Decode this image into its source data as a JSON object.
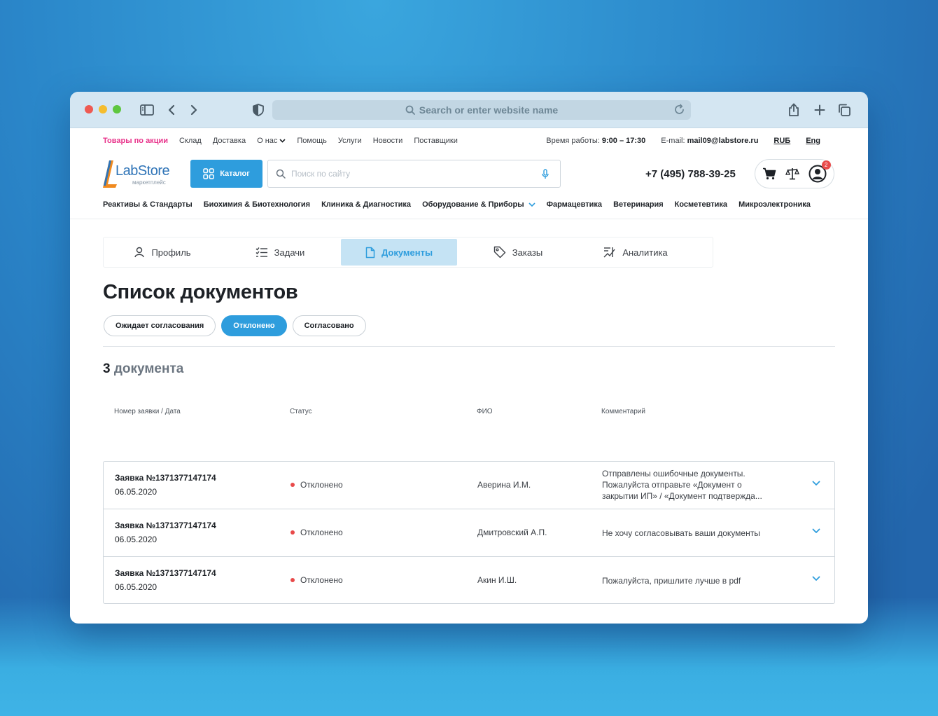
{
  "browser": {
    "url_placeholder": "Search or enter website name"
  },
  "topnav": {
    "links": [
      "Товары по акции",
      "Склад",
      "Доставка",
      "О нас",
      "Помощь",
      "Услуги",
      "Новости",
      "Поставщики"
    ],
    "work_hours_label": "Время работы:",
    "work_hours": "9:00 – 17:30",
    "email_label": "E-mail:",
    "email": "mail09@labstore.ru",
    "lang_ru": "RUБ",
    "lang_en": "Eng"
  },
  "header": {
    "logo_name": "LabStore",
    "logo_sub": "маркетплейс",
    "catalog_label": "Каталог",
    "search_placeholder": "Поиск по сайту",
    "phone": "+7 (495) 788-39-25",
    "profile_badge": "2"
  },
  "categories": [
    "Реактивы & Стандарты",
    "Биохимия & Биотехнология",
    "Клиника & Диагностика",
    "Оборудование & Приборы",
    "Фармацевтика",
    "Ветеринария",
    "Косметевтика",
    "Микроэлектроника"
  ],
  "tabs": [
    "Профиль",
    "Задачи",
    "Документы",
    "Заказы",
    "Аналитика"
  ],
  "page": {
    "title": "Список документов",
    "filters": [
      "Ожидает согласования",
      "Отклонено",
      "Согласовано"
    ],
    "count_num": "3",
    "count_word": "документа"
  },
  "table": {
    "headers": [
      "Номер заявки / Дата",
      "Статус",
      "ФИО",
      "Комментарий"
    ],
    "rows": [
      {
        "number": "Заявка №1371377147174",
        "date": "06.05.2020",
        "status": "Отклонено",
        "fio": "Аверина И.М.",
        "comment": "Отправлены ошибочные документы. Пожалуйста отправьте «Документ о закрытии ИП» / «Документ подтвержда..."
      },
      {
        "number": "Заявка №1371377147174",
        "date": "06.05.2020",
        "status": "Отклонено",
        "fio": "Дмитровский А.П.",
        "comment": "Не хочу согласовывать ваши документы"
      },
      {
        "number": "Заявка №1371377147174",
        "date": "06.05.2020",
        "status": "Отклонено",
        "fio": "Акин И.Ш.",
        "comment": "Пожалуйста, пришлите лучше в pdf"
      }
    ]
  },
  "colors": {
    "accent": "#2e9ddd",
    "promo": "#e8328a",
    "status_rejected": "#e84a4a"
  }
}
